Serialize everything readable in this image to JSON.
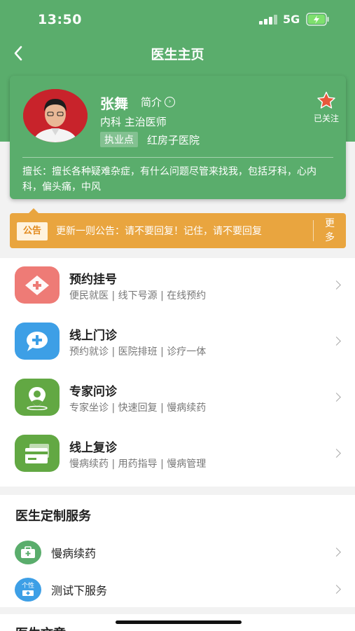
{
  "status_bar": {
    "time": "13:50",
    "network": "5G"
  },
  "nav": {
    "title": "医生主页",
    "back_icon": "back-chevron-icon"
  },
  "doctor": {
    "name": "张舞",
    "intro_label": "简介",
    "department_title": "内科 主治医师",
    "practice_tag": "执业点",
    "hospital": "红房子医院",
    "follow_label": "已关注",
    "specialty": "擅长：擅长各种疑难杂症，有什么问题尽管来找我，包括牙科，心内科，偏头痛，中风"
  },
  "notice": {
    "badge": "公告",
    "text": "更新一则公告：请不要回复！记住，请不要回复",
    "more": "更多"
  },
  "services": [
    {
      "title": "预约挂号",
      "subtitle": "便民就医 | 线下号源 | 在线预约",
      "icon": "medical-cross-icon",
      "color": "#ee7b76"
    },
    {
      "title": "线上门诊",
      "subtitle": "预约就诊  |  医院排班  |  诊疗一体",
      "icon": "chat-plus-icon",
      "color": "#3d9fe6"
    },
    {
      "title": "专家问诊",
      "subtitle": "专家坐诊 | 快速回复 | 慢病续药",
      "icon": "doctor-location-icon",
      "color": "#62a843"
    },
    {
      "title": "线上复诊",
      "subtitle": "慢病续药  |  用药指导  |  慢病管理",
      "icon": "card-icon",
      "color": "#62a843"
    }
  ],
  "custom_services": {
    "heading": "医生定制服务",
    "items": [
      {
        "label": "慢病续药",
        "icon": "medicine-box-icon",
        "color": "#5aad6c"
      },
      {
        "label": "测试下服务",
        "icon": "personal-service-icon",
        "color": "#3d9fe6",
        "icon_text": "个性"
      }
    ]
  },
  "articles": {
    "heading": "医生文章"
  },
  "colors": {
    "primary": "#5aad6c",
    "notice": "#e9a53f",
    "follow_star": "#e8583b"
  }
}
